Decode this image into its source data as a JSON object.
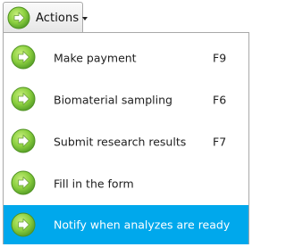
{
  "toolbar": {
    "actions_label": "Actions",
    "actions_icon": "arrow-right-circle-icon"
  },
  "menu": {
    "items": [
      {
        "label": "Make payment",
        "shortcut": "F9",
        "icon": "arrow-right-circle-icon"
      },
      {
        "label": "Biomaterial sampling",
        "shortcut": "F6",
        "icon": "arrow-right-circle-icon"
      },
      {
        "label": "Submit research results",
        "shortcut": "F7",
        "icon": "arrow-right-circle-icon"
      },
      {
        "label": "Fill in the form",
        "shortcut": "",
        "icon": "arrow-right-circle-icon"
      },
      {
        "label": "Notify when analyzes are ready",
        "shortcut": "",
        "icon": "arrow-right-circle-icon",
        "selected": true
      }
    ]
  },
  "colors": {
    "selection": "#00a8ec",
    "icon_green": "#7cc242",
    "border": "#a9a9a9"
  }
}
